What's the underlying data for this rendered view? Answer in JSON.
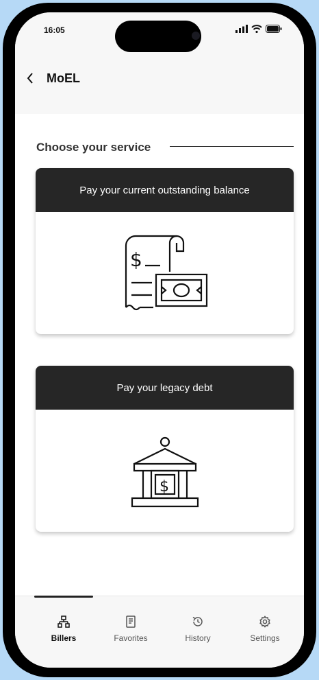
{
  "status": {
    "time": "16:05"
  },
  "header": {
    "title": "MoEL"
  },
  "section": {
    "title": "Choose your service"
  },
  "services": [
    {
      "label": "Pay your current outstanding balance",
      "icon": "bill-payment-icon"
    },
    {
      "label": "Pay your legacy debt",
      "icon": "bank-dollar-icon"
    }
  ],
  "tabs": [
    {
      "label": "Billers",
      "icon": "billers-icon",
      "active": true
    },
    {
      "label": "Favorites",
      "icon": "favorites-icon",
      "active": false
    },
    {
      "label": "History",
      "icon": "history-icon",
      "active": false
    },
    {
      "label": "Settings",
      "icon": "settings-icon",
      "active": false
    }
  ]
}
